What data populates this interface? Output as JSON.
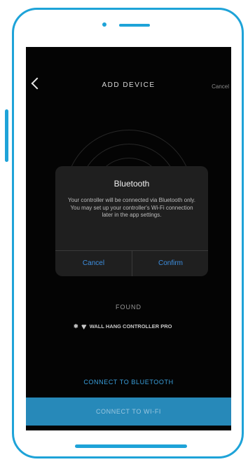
{
  "header": {
    "title": "ADD DEVICE",
    "cancel_label": "Cancel"
  },
  "dialog": {
    "title": "Bluetooth",
    "message": "Your controller will be connected via Bluetooth only. You may set up your controller's Wi-Fi connection later in the app settings.",
    "cancel_label": "Cancel",
    "confirm_label": "Confirm"
  },
  "found": {
    "label": "FOUND",
    "device_name": "WALL HANG CONTROLLER PRO"
  },
  "actions": {
    "connect_bluetooth_label": "CONNECT TO BLUETOOTH",
    "connect_wifi_label": "CONNECT TO WI-FI"
  },
  "icons": {
    "back": "chevron-left-icon",
    "bluetooth": "bluetooth-icon",
    "wifi": "wifi-icon"
  },
  "colors": {
    "frame": "#1ea3d8",
    "screen_bg": "#040404",
    "dialog_bg": "#1f1f1f",
    "dialog_button": "#3d8fe0",
    "wifi_button_bg": "#2789b9"
  }
}
